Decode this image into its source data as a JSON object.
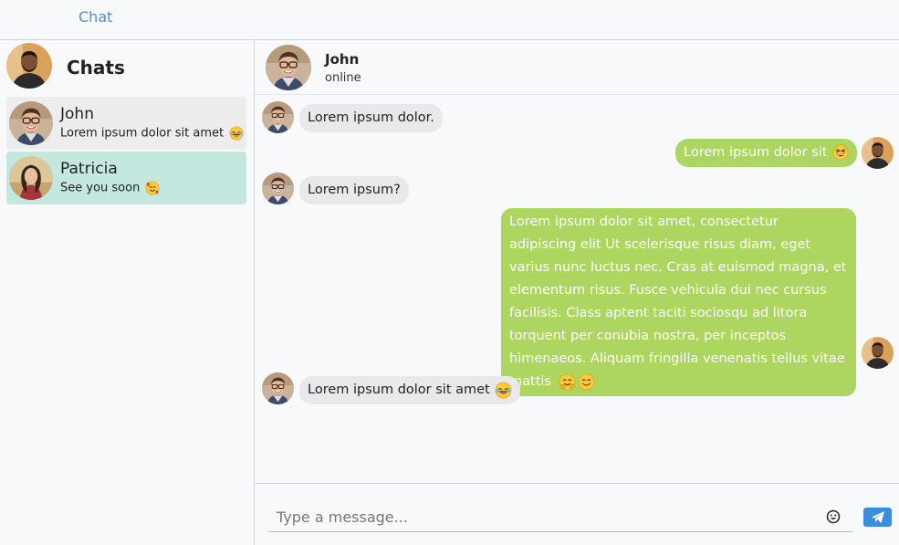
{
  "app": {
    "brand": "Chat"
  },
  "sidebar": {
    "title": "Chats",
    "contacts": [
      {
        "name": "John",
        "preview": "Lorem ipsum dolor sit amet",
        "preview_emoji": "laughing-tears-emoji"
      },
      {
        "name": "Patricia",
        "preview": "See you soon",
        "preview_emoji": "smiling-hearts-emoji"
      }
    ]
  },
  "chat": {
    "contact_name": "John",
    "contact_status": "online",
    "messages": [
      {
        "direction": "in",
        "text": "Lorem ipsum dolor."
      },
      {
        "direction": "out",
        "text": "Lorem ipsum dolor sit",
        "emoji": "grinning-squint-emoji"
      },
      {
        "direction": "in",
        "text": "Lorem ipsum?"
      },
      {
        "direction": "out",
        "text": "Lorem ipsum dolor sit amet, consectetur adipiscing elit Ut scelerisque risus diam, eget varius nunc luctus nec. Cras at euismod magna, et elementum risus. Fusce vehicula dui nec cursus facilisis. Class aptent taciti sociosqu ad litora torquent per conubia nostra, per inceptos himenaeos. Aliquam fringilla venenatis tellus vitae mattis",
        "emoji": "hugging-and-smiling-emoji"
      },
      {
        "direction": "in",
        "text": "Lorem ipsum dolor sit amet",
        "emoji": "laughing-tears-emoji"
      }
    ]
  },
  "composer": {
    "placeholder": "Type a message...",
    "emoji_icon": "smiley-icon",
    "send_icon": "paper-plane-icon"
  },
  "colors": {
    "accent": "#4a8fd0",
    "outgoing_bubble": "#acd65f",
    "incoming_bubble": "#e9e9eb",
    "selected_contact": "#c3e8df",
    "send_button": "#3b8fd9"
  }
}
